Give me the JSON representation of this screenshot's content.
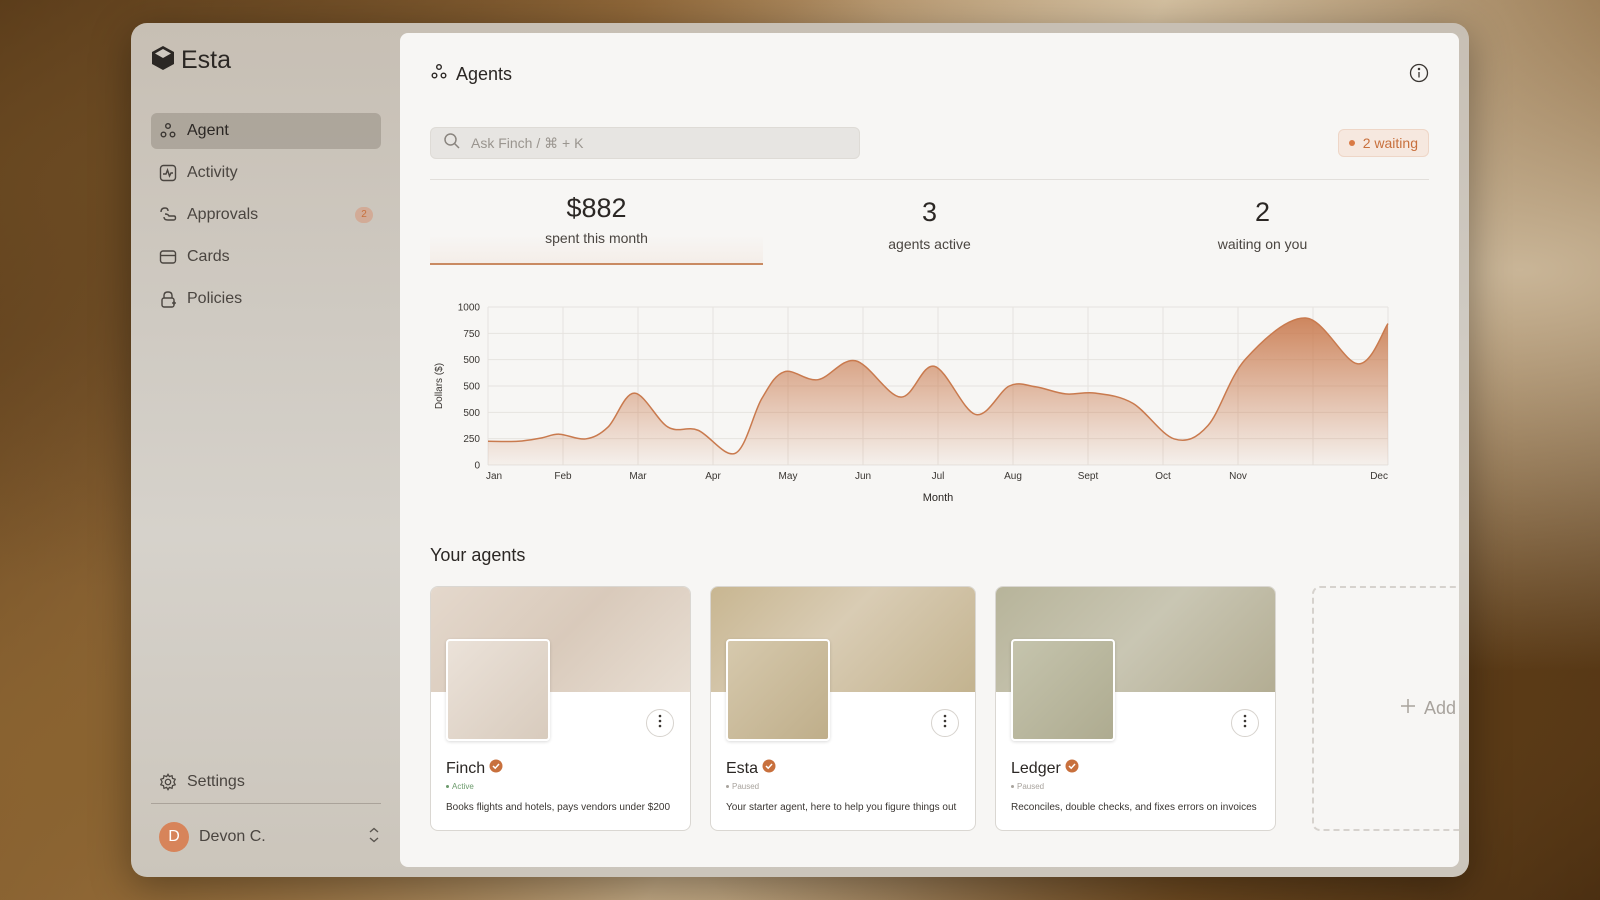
{
  "app": {
    "name": "Esta"
  },
  "sidebar": {
    "items": [
      {
        "label": "Agent",
        "icon": "agents-icon",
        "active": true
      },
      {
        "label": "Activity",
        "icon": "activity-icon"
      },
      {
        "label": "Approvals",
        "icon": "approvals-icon",
        "badge": "2"
      },
      {
        "label": "Cards",
        "icon": "card-icon"
      },
      {
        "label": "Policies",
        "icon": "lock-icon"
      }
    ],
    "settings_label": "Settings",
    "user": {
      "initial": "D",
      "name": "Devon C."
    }
  },
  "header": {
    "title": "Agents",
    "icon": "agents-icon"
  },
  "search": {
    "placeholder": "Ask Finch / ⌘ + K",
    "value": ""
  },
  "waiting_pill": {
    "label": "2 waiting"
  },
  "stats": [
    {
      "value": "$882",
      "label": "spent this month",
      "selected": true
    },
    {
      "value": "3",
      "label": "agents active"
    },
    {
      "value": "2",
      "label": "waiting on you"
    }
  ],
  "chart_data": {
    "type": "area",
    "xlabel": "Month",
    "ylabel": "Dollars ($)",
    "y_tick_labels": [
      "0",
      "250",
      "500",
      "500",
      "500",
      "750",
      "1000"
    ],
    "x_tick_labels": [
      "Jan",
      "Feb",
      "Mar",
      "Apr",
      "May",
      "Jun",
      "Jul",
      "Aug",
      "Sept",
      "Oct",
      "Nov",
      "Dec"
    ],
    "ylim": [
      0,
      1000
    ],
    "xlim": [
      0,
      12
    ],
    "grid": true,
    "color": "#c97a4e",
    "points": [
      [
        0,
        150
      ],
      [
        0.4,
        150
      ],
      [
        0.7,
        170
      ],
      [
        0.95,
        195
      ],
      [
        1.3,
        165
      ],
      [
        1.6,
        240
      ],
      [
        1.95,
        455
      ],
      [
        2.4,
        240
      ],
      [
        2.8,
        220
      ],
      [
        3.3,
        75
      ],
      [
        3.65,
        420
      ],
      [
        3.95,
        590
      ],
      [
        4.4,
        540
      ],
      [
        4.9,
        660
      ],
      [
        5.5,
        430
      ],
      [
        5.95,
        625
      ],
      [
        6.5,
        320
      ],
      [
        6.95,
        500
      ],
      [
        7.3,
        495
      ],
      [
        7.7,
        450
      ],
      [
        8.1,
        455
      ],
      [
        8.6,
        390
      ],
      [
        9.15,
        165
      ],
      [
        9.6,
        250
      ],
      [
        10.1,
        670
      ],
      [
        10.9,
        930
      ],
      [
        11.6,
        640
      ],
      [
        12,
        895
      ]
    ]
  },
  "agents_section": {
    "title": "Your agents"
  },
  "agents": [
    {
      "name": "Finch",
      "status": "Active",
      "description": "Books flights and hotels, pays vendors under $200"
    },
    {
      "name": "Esta",
      "status": "Paused",
      "description": "Your starter agent, here to help you figure things out"
    },
    {
      "name": "Ledger",
      "status": "Paused",
      "description": "Reconciles, double checks, and fixes errors on invoices"
    }
  ],
  "add_agent": {
    "label": "Add"
  },
  "colors": {
    "accent": "#c97a4e",
    "verified": "#c8703d",
    "active_status": "#6b9a6b"
  }
}
